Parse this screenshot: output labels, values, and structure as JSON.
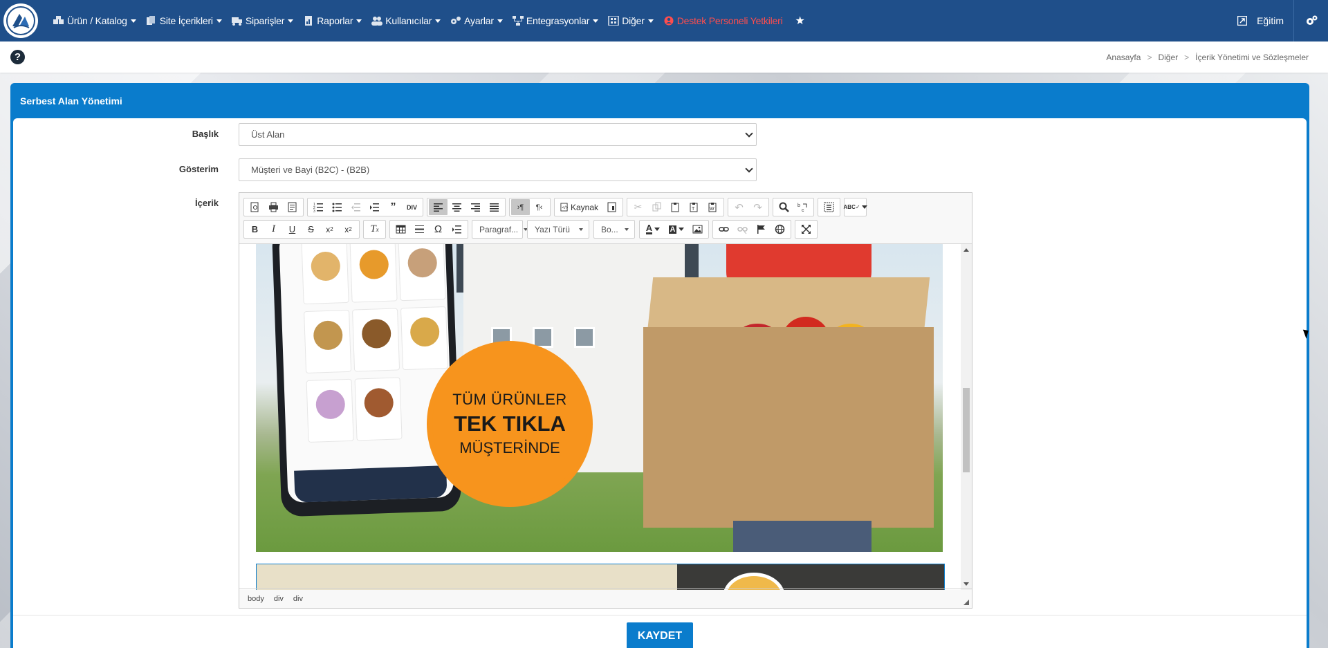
{
  "nav": {
    "items": [
      {
        "label": "Ürün / Katalog",
        "icon": "boxes-icon"
      },
      {
        "label": "Site İçerikleri",
        "icon": "copy-icon"
      },
      {
        "label": "Siparişler",
        "icon": "truck-icon"
      },
      {
        "label": "Raporlar",
        "icon": "report-icon"
      },
      {
        "label": "Kullanıcılar",
        "icon": "users-icon"
      },
      {
        "label": "Ayarlar",
        "icon": "cogs-icon"
      },
      {
        "label": "Entegrasyonlar",
        "icon": "sitemap-icon"
      },
      {
        "label": "Diğer",
        "icon": "grid-icon"
      }
    ],
    "support": "Destek Personeli Yetkileri",
    "user": "Eğitim"
  },
  "breadcrumb": {
    "home": "Anasayfa",
    "parent": "Diğer",
    "current": "İçerik Yönetimi ve Sözleşmeler"
  },
  "panel": {
    "title": "Serbest Alan Yönetimi"
  },
  "form": {
    "title_label": "Başlık",
    "title_value": "Üst Alan",
    "display_label": "Gösterim",
    "display_value": "Müşteri ve Bayi (B2C) - (B2B)",
    "content_label": "İçerik"
  },
  "editor": {
    "source_label": "Kaynak",
    "paragraph_combo": "Paragraf...",
    "font_combo": "Yazı Türü",
    "size_combo": "Bo...",
    "path": [
      "body",
      "div",
      "div"
    ]
  },
  "banner": {
    "line1": "TÜM ÜRÜNLER",
    "line2": "TEK TIKLA",
    "line3": "MÜŞTERİNDE"
  },
  "save_label": "KAYDET",
  "colors": {
    "nav_bg": "#1f4f8a",
    "panel": "#0a7ccc",
    "support": "#ff4d4d"
  }
}
